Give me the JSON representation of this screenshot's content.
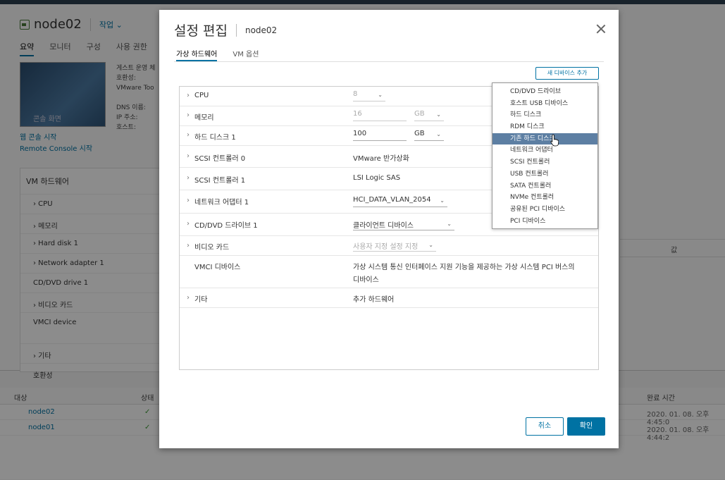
{
  "background": {
    "vm_name": "node02",
    "actions_label": "작업 ⌄",
    "tabs": [
      "요약",
      "모니터",
      "구성",
      "사용 권한"
    ],
    "thumb_label": "콘솔 화면",
    "info_lines": [
      "게스트 운영 체",
      "호환성:",
      "VMware Too",
      "",
      "DNS 이름:",
      "IP 주소:",
      "호스트:"
    ],
    "links": [
      "웹 콘솔 시작",
      "Remote Console 시작"
    ],
    "panel_title": "VM 하드웨어",
    "panel_rows": [
      "› CPU",
      "› 메모리",
      "› Hard disk 1",
      "› Network adapter 1",
      "CD/DVD drive 1",
      "› 비디오 카드",
      "VMCI device",
      "",
      "› 기타",
      "호환성"
    ],
    "right_col_header": "값",
    "tasks_headers": [
      "대상",
      "상태",
      "완료 시간"
    ],
    "tasks_rows": [
      {
        "target": "node02",
        "status": "✓",
        "time": "2020. 01. 08. 오후 4:45:0"
      },
      {
        "target": "node01",
        "status": "✓",
        "time": "2020. 01. 08. 오후 4:44:2"
      }
    ]
  },
  "modal": {
    "title": "설정 편집",
    "subtitle": "node02",
    "tabs": [
      "가상 하드웨어",
      "VM 옵션"
    ],
    "add_device_label": "새 디바이스 추가",
    "rows": {
      "cpu": {
        "label": "CPU",
        "value": "8"
      },
      "memory": {
        "label": "메모리",
        "value": "16",
        "unit": "GB"
      },
      "disk": {
        "label": "하드 디스크 1",
        "value": "100",
        "unit": "GB"
      },
      "scsi0": {
        "label": "SCSI 컨트롤러 0",
        "value": "VMware 반가상화"
      },
      "scsi1": {
        "label": "SCSI 컨트롤러 1",
        "value": "LSI Logic SAS"
      },
      "net": {
        "label": "네트워크 어댑터 1",
        "value": "HCI_DATA_VLAN_2054"
      },
      "cd": {
        "label": "CD/DVD 드라이브 1",
        "value": "클라이언트 디바이스"
      },
      "video": {
        "label": "비디오 카드",
        "value": "사용자 지정 설정 지정"
      },
      "vmci": {
        "label": "VMCI 디바이스",
        "value_line1": "가상 시스템 통신 인터페이스 지원 기능을 제공하는 가상 시스템 PCI 버스의",
        "value_line2": "디바이스"
      },
      "other": {
        "label": "기타",
        "value": "추가 하드웨어"
      }
    },
    "menu_items": [
      "CD/DVD 드라이브",
      "호스트 USB 디바이스",
      "하드 디스크",
      "RDM 디스크",
      "기존 하드 디스크",
      "네트워크 어댑터",
      "SCSI 컨트롤러",
      "USB 컨트롤러",
      "SATA 컨트롤러",
      "NVMe 컨트롤러",
      "공유된 PCI 디바이스",
      "PCI 디바이스"
    ],
    "menu_highlighted_index": 4,
    "cancel_label": "취소",
    "ok_label": "확인"
  }
}
